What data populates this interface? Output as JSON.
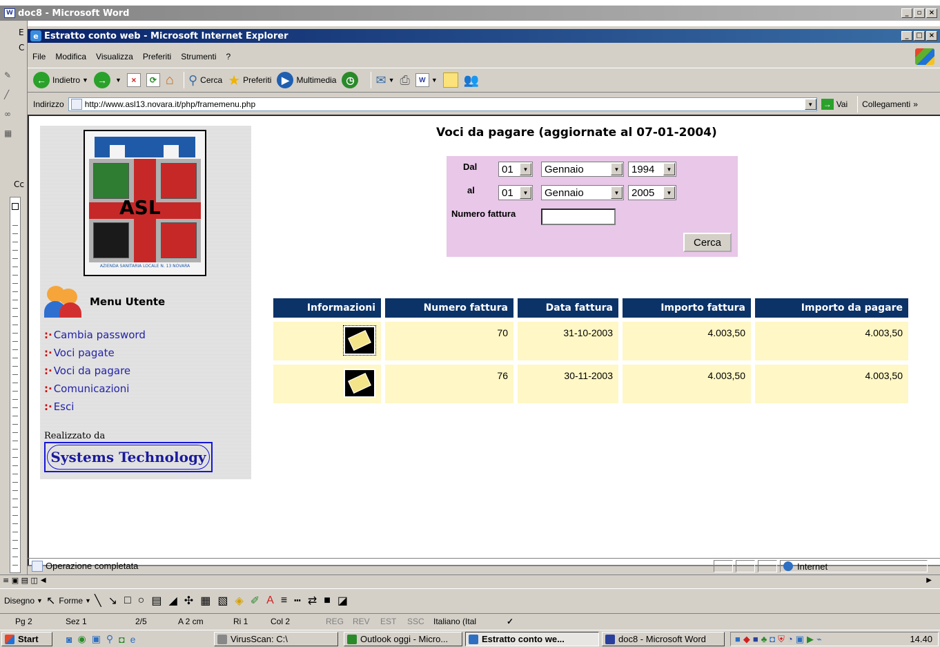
{
  "word": {
    "title": "doc8 - Microsoft Word",
    "left_letters": [
      "E",
      "C",
      "Cc"
    ]
  },
  "ie": {
    "title": "Estratto conto web - Microsoft Internet Explorer",
    "menu": [
      "File",
      "Modifica",
      "Visualizza",
      "Preferiti",
      "Strumenti",
      "?"
    ],
    "toolbar": {
      "back": "Indietro",
      "search": "Cerca",
      "favorites": "Preferiti",
      "media": "Multimedia"
    },
    "address_label": "Indirizzo",
    "url": "http://www.asl13.novara.it/php/framemenu.php",
    "go": "Vai",
    "links": "Collegamenti",
    "links_chevron": "»",
    "status": "Operazione completata",
    "zone": "Internet"
  },
  "page": {
    "heading": "Voci da pagare (aggiornate al 07-01-2004)",
    "menu_title": "Menu Utente",
    "menu_items": [
      "Cambia password",
      "Voci pagate",
      "Voci da pagare",
      "Comunicazioni",
      "Esci"
    ],
    "credit_label": "Realizzato da",
    "credit_logo": "Systems Technology",
    "logo_text": "ASL",
    "logo_bottom": "AZIENDA SANITARIA LOCALE N. 13 NOVARA"
  },
  "form": {
    "dal_label": "Dal",
    "al_label": "al",
    "numero_label": "Numero fattura",
    "dal": {
      "day": "01",
      "month": "Gennaio",
      "year": "1994"
    },
    "al": {
      "day": "01",
      "month": "Gennaio",
      "year": "2005"
    },
    "numero_value": "",
    "cerca": "Cerca"
  },
  "table": {
    "headers": [
      "Informazioni",
      "Numero fattura",
      "Data fattura",
      "Importo fattura",
      "Importo da pagare"
    ],
    "rows": [
      {
        "numero": "70",
        "data": "31-10-2003",
        "importo": "4.003,50",
        "da_pagare": "4.003,50"
      },
      {
        "numero": "76",
        "data": "30-11-2003",
        "importo": "4.003,50",
        "da_pagare": "4.003,50"
      }
    ]
  },
  "word_draw": {
    "disegno": "Disegno",
    "forme": "Forme"
  },
  "word_status": {
    "page": "Pg 2",
    "section": "Sez 1",
    "pages": "2/5",
    "at": "A 2 cm",
    "line": "Ri 1",
    "col": "Col 2",
    "rec": "REG",
    "trk": "REV",
    "ext": "EST",
    "ovr": "SSC",
    "lang": "Italiano (Ital"
  },
  "taskbar": {
    "start": "Start",
    "items": [
      "VirusScan: C:\\",
      "Outlook oggi - Micro...",
      "Estratto conto we...",
      "doc8 - Microsoft Word"
    ],
    "clock": "14.40"
  }
}
